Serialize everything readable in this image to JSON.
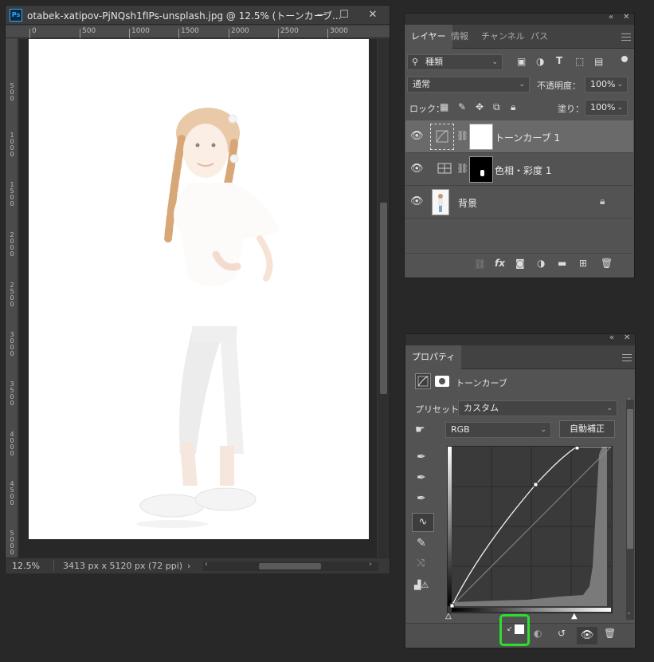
{
  "document": {
    "title": "otabek-xatipov-PjNQsh1fIPs-unsplash.jpg @ 12.5% (トーンカーブ...",
    "app_badge": "Ps",
    "ruler_top_ticks": [
      "0",
      "500",
      "1000",
      "1500",
      "2000",
      "2500",
      "3000"
    ],
    "ruler_left_ticks": [
      "5\n0\n0",
      "1\n0\n0\n0",
      "1\n5\n0\n0",
      "2\n0\n0\n0",
      "2\n5\n0\n0",
      "3\n0\n0\n0",
      "3\n5\n0\n0",
      "4\n0\n0\n0",
      "4\n5\n0\n0",
      "5\n0\n0\n0"
    ],
    "zoom": "12.5%",
    "info": "3413 px x 5120 px (72 ppi)"
  },
  "layers_panel": {
    "tabs": [
      "レイヤー",
      "情報",
      "チャンネル",
      "パス"
    ],
    "filter_label": "種類",
    "blend_mode": "通常",
    "opacity_label": "不透明度：",
    "opacity_value": "100%",
    "lock_label": "ロック：",
    "fill_label": "塗り：",
    "fill_value": "100%",
    "layers": [
      {
        "name": "トーンカーブ 1",
        "selected": true
      },
      {
        "name": "色相・彩度 1",
        "selected": false
      },
      {
        "name": "背景",
        "selected": false
      }
    ]
  },
  "properties_panel": {
    "tab": "プロパティ",
    "type_label": "トーンカーブ",
    "preset_label": "プリセット：",
    "preset_value": "カスタム",
    "channel_value": "RGB",
    "auto_button": "自動補正"
  },
  "colors": {
    "highlight": "#2dde2d",
    "panel_bg": "#535353",
    "app_bg": "#282828"
  }
}
